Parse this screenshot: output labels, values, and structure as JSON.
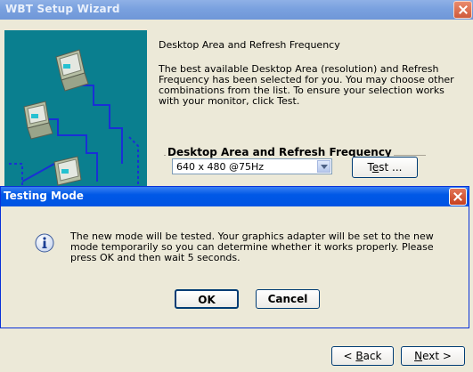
{
  "window": {
    "title": "WBT Setup Wizard"
  },
  "main": {
    "heading": "Desktop Area and Refresh Frequency",
    "description": "The best available Desktop Area (resolution) and Refresh Frequency has been selected for you.  You may choose other combinations from the list.  To ensure your selection works with your monitor, click Test.",
    "group_label": "Desktop Area and Refresh Frequency",
    "mode_select_value": "640 x 480 @75Hz",
    "test_button": {
      "pre": "T",
      "u": "e",
      "post": "st ..."
    }
  },
  "dialog": {
    "title": "Testing Mode",
    "message": "The new mode will be tested.  Your graphics adapter will be set to the new mode temporarily so you can determine whether it works properly. Please press OK and then wait 5 seconds.",
    "ok_label": "OK",
    "cancel_label": "Cancel"
  },
  "footer": {
    "back_button": {
      "pre": "< ",
      "u": "B",
      "post": "ack"
    },
    "next_button": {
      "pre": "",
      "u": "N",
      "post": "ext >"
    }
  }
}
